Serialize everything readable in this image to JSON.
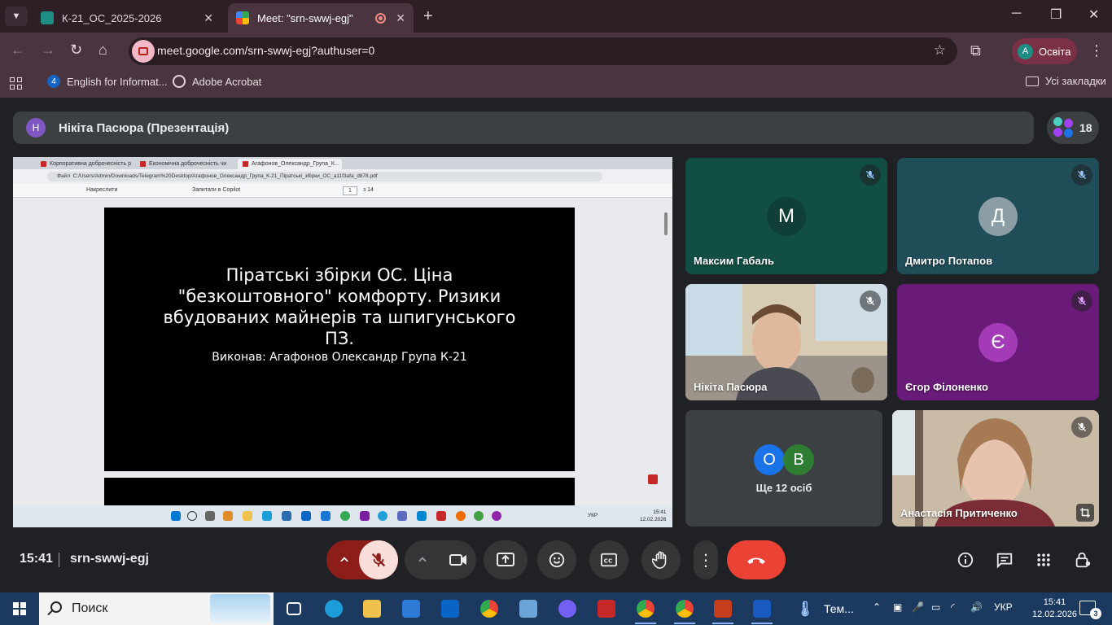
{
  "browser": {
    "tabs": [
      {
        "title": "К-21_ОС_2025-2026",
        "close": "✕"
      },
      {
        "title": "Meet: \"srn-swwj-egj\"",
        "close": "✕"
      }
    ],
    "new_tab": "+",
    "window_controls": {
      "minimize": "─",
      "restore": "❐",
      "close": "✕"
    },
    "url": "meet.google.com/srn-swwj-egj?authuser=0",
    "profile": {
      "initial": "A",
      "name": "Освіта"
    },
    "bookmarks": [
      {
        "label": "English for Informat...",
        "icon": "4"
      },
      {
        "label": "Adobe Acrobat",
        "icon": ""
      }
    ],
    "all_bookmarks": "Усі закладки"
  },
  "meet": {
    "presenter": {
      "initial": "Н",
      "label": "Нікіта Пасюра (Презентація)"
    },
    "participants_count": "18",
    "time": "15:41",
    "meeting_code": "srn-swwj-egj",
    "tiles": [
      {
        "name": "Максим Габаль",
        "initial": "М",
        "avatar_color": "#0f3f37",
        "muted": true
      },
      {
        "name": "Дмитро Потапов",
        "initial": "Д",
        "avatar_color": "#8b9ea6",
        "muted": true
      },
      {
        "name": "Нікіта Пасюра",
        "video": true,
        "muted": true
      },
      {
        "name": "Єгор Філоненко",
        "initial": "Є",
        "avatar_color": "#a23bb5",
        "muted": true
      },
      {
        "name": "Анастасія Притиченко",
        "video": true,
        "muted": true
      }
    ],
    "more": {
      "label": "Ще 12 осіб",
      "initials": [
        "О",
        "В"
      ],
      "colors": [
        "#1a73e8",
        "#2e7d32"
      ]
    }
  },
  "shared_screen": {
    "tabs": [
      "Корпоративна доброчесність р",
      "Економічна доброчесність чи",
      "Агафонов_Олександр_Група_К..."
    ],
    "file_label": "Файл",
    "address": "C:/Users/Admin/Downloads/Telegram%20Desktop/Агафонов_Олександр_Група_К-21_Піратські_збірки_ОС_a11f3afa_d878.pdf",
    "pdf_toolbar": {
      "draw": "Накреслити",
      "copilot": "Запитати в Copilot",
      "page": "1",
      "of": "з 14"
    },
    "slide": {
      "title": "Піратські збірки ОС. Ціна \"безкоштовного\" комфорту. Ризики вбудованих майнерів та шпигунського ПЗ.",
      "author": "Виконав: Агафонов Олександр Група К-21"
    },
    "taskbar_lang": "УКР",
    "clock": {
      "time": "15:41",
      "date": "12.02.2026"
    }
  },
  "windows_taskbar": {
    "search_placeholder": "Поиск",
    "weather_label": "Тем...",
    "lang": "УКР",
    "time": "15:41",
    "date": "12.02.2026",
    "notifications": "3"
  }
}
